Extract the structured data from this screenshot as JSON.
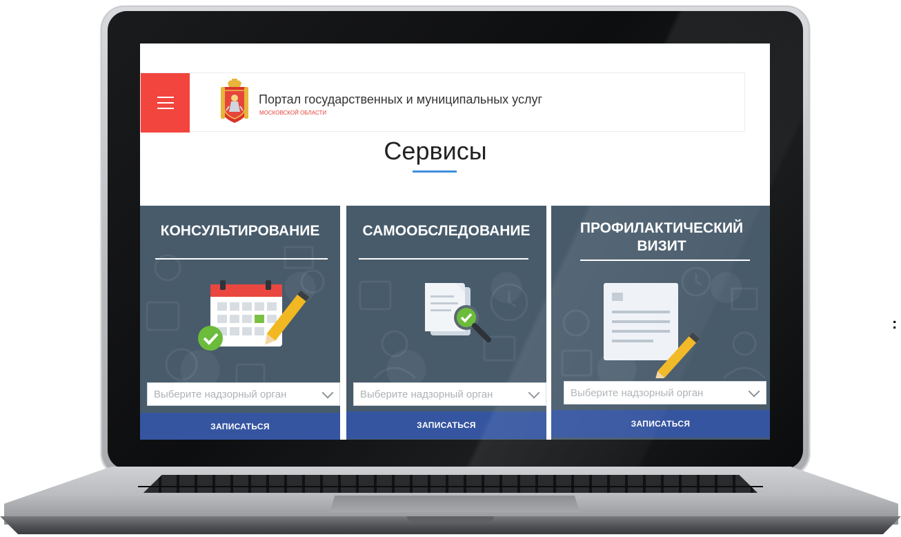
{
  "header": {
    "menu_icon": "hamburger-menu-icon",
    "logo_icon": "moscow-oblast-coat-of-arms-icon",
    "portal_title": "Портал государственных и муниципальных услуг",
    "portal_subtitle": "МОСКОВСКОЙ ОБЛАСТИ"
  },
  "section": {
    "title": "Сервисы"
  },
  "cards": [
    {
      "title": "КОНСУЛЬТИРОВАНИЕ",
      "icon": "calendar-pencil-check-icon",
      "select_placeholder": "Выберите надзорный орган",
      "button_label": "ЗАПИСАТЬСЯ"
    },
    {
      "title": "САМООБСЛЕДОВАНИЕ",
      "icon": "documents-magnifier-check-icon",
      "select_placeholder": "Выберите надзорный орган",
      "button_label": "ЗАПИСАТЬСЯ"
    },
    {
      "title": "ПРОФИЛАКТИЧЕСКИЙ ВИЗИТ",
      "icon": "document-pencil-icon",
      "select_placeholder": "Выберите надзорный орган",
      "button_label": "ЗАПИСАТЬСЯ"
    }
  ],
  "colors": {
    "menu_accent": "#f2453e",
    "card_background": "#485b6b",
    "button_blue": "#3555a0",
    "underline_blue": "#3d8edc"
  }
}
